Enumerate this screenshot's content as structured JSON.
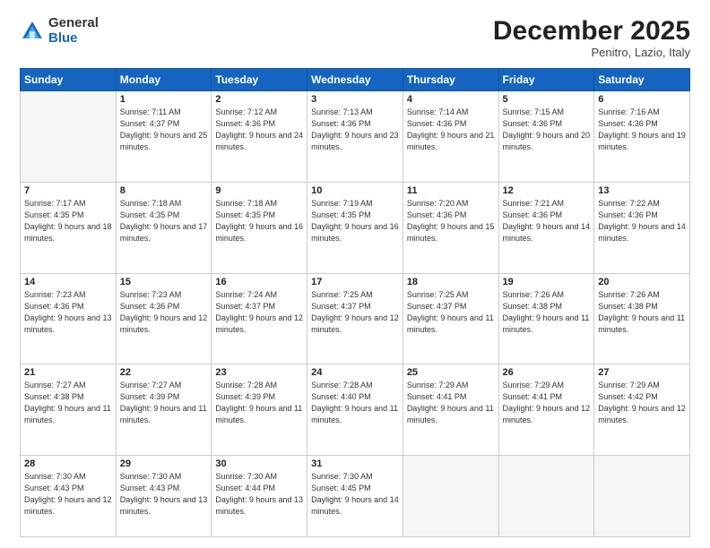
{
  "header": {
    "logo_general": "General",
    "logo_blue": "Blue",
    "month_title": "December 2025",
    "location": "Penitro, Lazio, Italy"
  },
  "weekdays": [
    "Sunday",
    "Monday",
    "Tuesday",
    "Wednesday",
    "Thursday",
    "Friday",
    "Saturday"
  ],
  "weeks": [
    [
      {
        "day": "",
        "empty": true
      },
      {
        "day": "1",
        "sunrise": "7:11 AM",
        "sunset": "4:37 PM",
        "daylight": "9 hours and 25 minutes."
      },
      {
        "day": "2",
        "sunrise": "7:12 AM",
        "sunset": "4:36 PM",
        "daylight": "9 hours and 24 minutes."
      },
      {
        "day": "3",
        "sunrise": "7:13 AM",
        "sunset": "4:36 PM",
        "daylight": "9 hours and 23 minutes."
      },
      {
        "day": "4",
        "sunrise": "7:14 AM",
        "sunset": "4:36 PM",
        "daylight": "9 hours and 21 minutes."
      },
      {
        "day": "5",
        "sunrise": "7:15 AM",
        "sunset": "4:36 PM",
        "daylight": "9 hours and 20 minutes."
      },
      {
        "day": "6",
        "sunrise": "7:16 AM",
        "sunset": "4:36 PM",
        "daylight": "9 hours and 19 minutes."
      }
    ],
    [
      {
        "day": "7",
        "sunrise": "7:17 AM",
        "sunset": "4:35 PM",
        "daylight": "9 hours and 18 minutes."
      },
      {
        "day": "8",
        "sunrise": "7:18 AM",
        "sunset": "4:35 PM",
        "daylight": "9 hours and 17 minutes."
      },
      {
        "day": "9",
        "sunrise": "7:18 AM",
        "sunset": "4:35 PM",
        "daylight": "9 hours and 16 minutes."
      },
      {
        "day": "10",
        "sunrise": "7:19 AM",
        "sunset": "4:35 PM",
        "daylight": "9 hours and 16 minutes."
      },
      {
        "day": "11",
        "sunrise": "7:20 AM",
        "sunset": "4:36 PM",
        "daylight": "9 hours and 15 minutes."
      },
      {
        "day": "12",
        "sunrise": "7:21 AM",
        "sunset": "4:36 PM",
        "daylight": "9 hours and 14 minutes."
      },
      {
        "day": "13",
        "sunrise": "7:22 AM",
        "sunset": "4:36 PM",
        "daylight": "9 hours and 14 minutes."
      }
    ],
    [
      {
        "day": "14",
        "sunrise": "7:23 AM",
        "sunset": "4:36 PM",
        "daylight": "9 hours and 13 minutes."
      },
      {
        "day": "15",
        "sunrise": "7:23 AM",
        "sunset": "4:36 PM",
        "daylight": "9 hours and 12 minutes."
      },
      {
        "day": "16",
        "sunrise": "7:24 AM",
        "sunset": "4:37 PM",
        "daylight": "9 hours and 12 minutes."
      },
      {
        "day": "17",
        "sunrise": "7:25 AM",
        "sunset": "4:37 PM",
        "daylight": "9 hours and 12 minutes."
      },
      {
        "day": "18",
        "sunrise": "7:25 AM",
        "sunset": "4:37 PM",
        "daylight": "9 hours and 11 minutes."
      },
      {
        "day": "19",
        "sunrise": "7:26 AM",
        "sunset": "4:38 PM",
        "daylight": "9 hours and 11 minutes."
      },
      {
        "day": "20",
        "sunrise": "7:26 AM",
        "sunset": "4:38 PM",
        "daylight": "9 hours and 11 minutes."
      }
    ],
    [
      {
        "day": "21",
        "sunrise": "7:27 AM",
        "sunset": "4:38 PM",
        "daylight": "9 hours and 11 minutes."
      },
      {
        "day": "22",
        "sunrise": "7:27 AM",
        "sunset": "4:39 PM",
        "daylight": "9 hours and 11 minutes."
      },
      {
        "day": "23",
        "sunrise": "7:28 AM",
        "sunset": "4:39 PM",
        "daylight": "9 hours and 11 minutes."
      },
      {
        "day": "24",
        "sunrise": "7:28 AM",
        "sunset": "4:40 PM",
        "daylight": "9 hours and 11 minutes."
      },
      {
        "day": "25",
        "sunrise": "7:29 AM",
        "sunset": "4:41 PM",
        "daylight": "9 hours and 11 minutes."
      },
      {
        "day": "26",
        "sunrise": "7:29 AM",
        "sunset": "4:41 PM",
        "daylight": "9 hours and 12 minutes."
      },
      {
        "day": "27",
        "sunrise": "7:29 AM",
        "sunset": "4:42 PM",
        "daylight": "9 hours and 12 minutes."
      }
    ],
    [
      {
        "day": "28",
        "sunrise": "7:30 AM",
        "sunset": "4:43 PM",
        "daylight": "9 hours and 12 minutes."
      },
      {
        "day": "29",
        "sunrise": "7:30 AM",
        "sunset": "4:43 PM",
        "daylight": "9 hours and 13 minutes."
      },
      {
        "day": "30",
        "sunrise": "7:30 AM",
        "sunset": "4:44 PM",
        "daylight": "9 hours and 13 minutes."
      },
      {
        "day": "31",
        "sunrise": "7:30 AM",
        "sunset": "4:45 PM",
        "daylight": "9 hours and 14 minutes."
      },
      {
        "day": "",
        "empty": true
      },
      {
        "day": "",
        "empty": true
      },
      {
        "day": "",
        "empty": true
      }
    ]
  ]
}
